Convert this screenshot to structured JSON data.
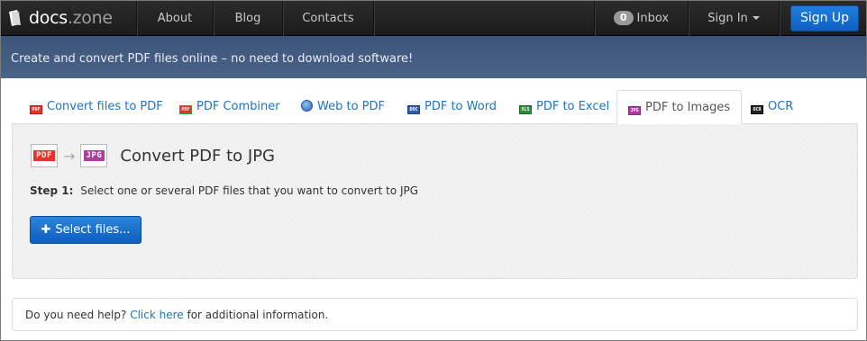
{
  "brand": {
    "name": "docs",
    "suffix": ".zone"
  },
  "nav": {
    "about": "About",
    "blog": "Blog",
    "contacts": "Contacts",
    "inbox_count": "0",
    "inbox": "Inbox",
    "sign_in": "Sign In",
    "sign_up": "Sign Up"
  },
  "banner": {
    "text": "Create and convert PDF files online – no need to download software!"
  },
  "tabs": [
    {
      "label": "Convert files to PDF",
      "icon": "pdf-file-icon",
      "badge": "PDF",
      "color": "#d23a2a"
    },
    {
      "label": "PDF Combiner",
      "icon": "pdf-combine-icon",
      "badge": "PDF",
      "color": "#3a9a3a"
    },
    {
      "label": "Web to PDF",
      "icon": "globe-icon",
      "badge": "",
      "color": "#3a6fc2"
    },
    {
      "label": "PDF to Word",
      "icon": "doc-file-icon",
      "badge": "DOC",
      "color": "#2f5fa8"
    },
    {
      "label": "PDF to Excel",
      "icon": "xls-file-icon",
      "badge": "XLS",
      "color": "#2e8b3a"
    },
    {
      "label": "PDF to Images",
      "icon": "jpg-file-icon",
      "badge": "JPG",
      "color": "#a23a9a",
      "active": true
    },
    {
      "label": "OCR",
      "icon": "ocr-file-icon",
      "badge": "OCR",
      "color": "#222222"
    }
  ],
  "converter": {
    "from_badge": "PDF",
    "to_badge": "JPG",
    "title": "Convert PDF to JPG",
    "step_label": "Step 1:",
    "step_text": "Select one or several PDF files that you want to convert to JPG",
    "select_button": "Select files..."
  },
  "help": {
    "prefix": "Do you need help?",
    "link": "Click here",
    "suffix": "for additional information."
  },
  "colors": {
    "accent": "#1f74c2",
    "navbar": "#1f1f1f",
    "banner": "#445d82",
    "pdf_red": "#e8332a",
    "jpg_purple": "#b03aa0"
  }
}
